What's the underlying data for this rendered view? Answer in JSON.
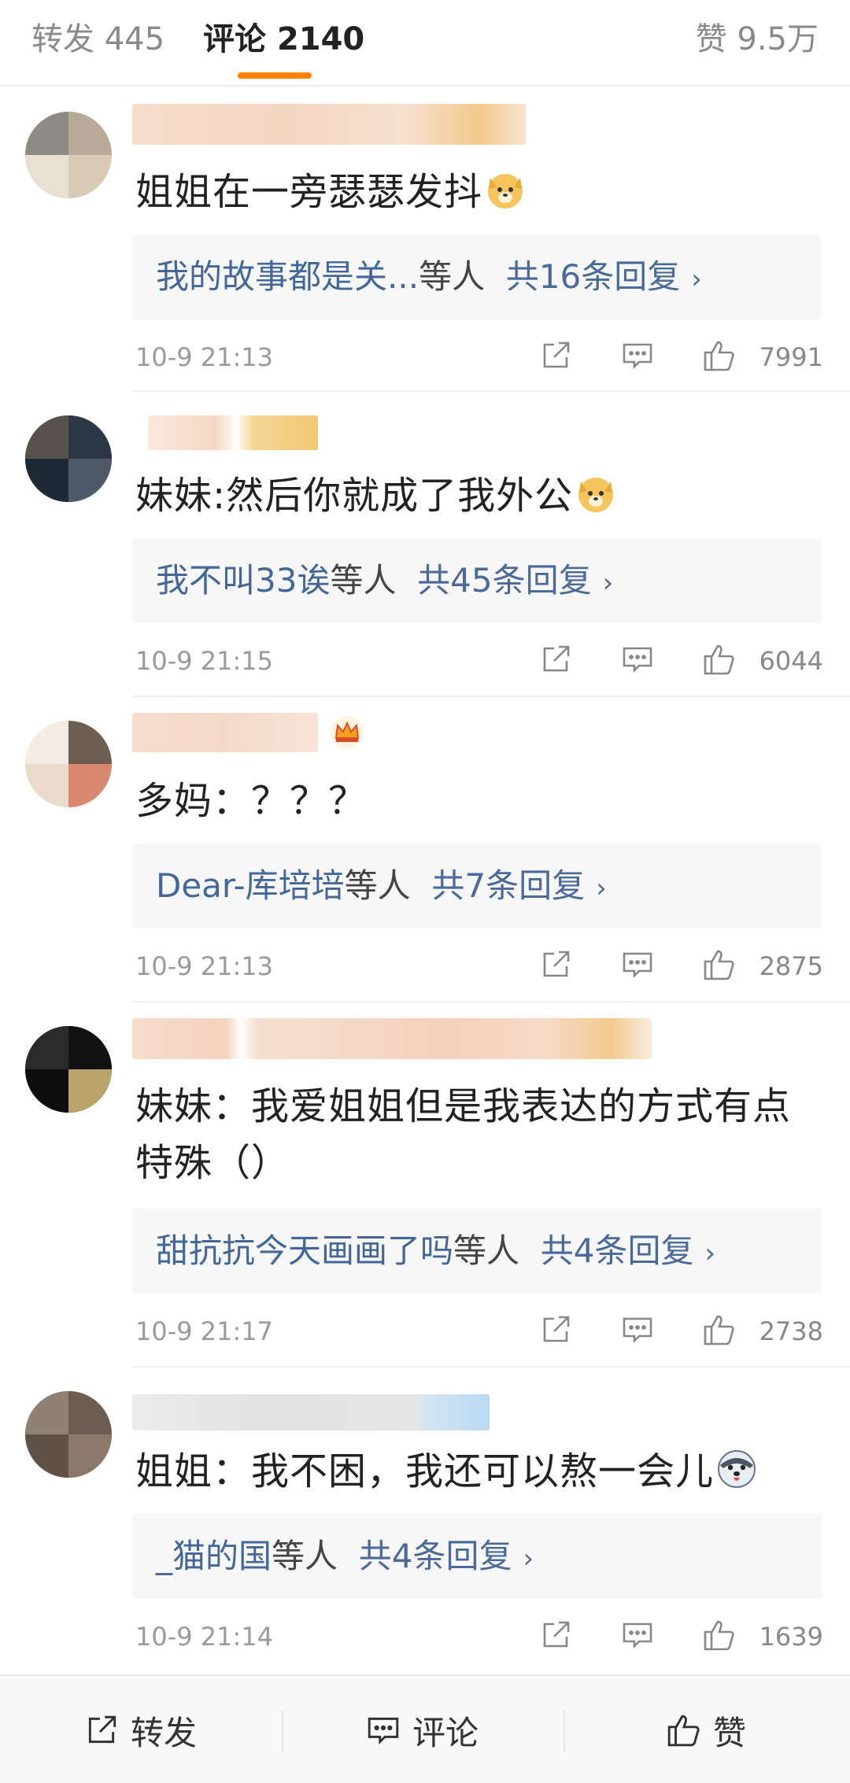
{
  "tabs": {
    "repost_label": "转发",
    "repost_count": "445",
    "comments_label": "评论",
    "comments_count": "2140",
    "likes_label": "赞",
    "likes_count": "9.5万"
  },
  "comments": [
    {
      "text": "姐姐在一旁瑟瑟发抖",
      "emoji": "doge-emoji",
      "reply_users": "我的故事都是关...",
      "reply_etc": "等人",
      "reply_total": "共16条回复",
      "time": "10-9 21:13",
      "likes": "7991"
    },
    {
      "text": "妹妹:然后你就成了我外公",
      "emoji": "doge-emoji",
      "reply_users": "我不叫33诶",
      "reply_etc": "等人",
      "reply_total": "共45条回复",
      "time": "10-9 21:15",
      "likes": "6044"
    },
    {
      "text": "多妈：？？？",
      "emoji": "",
      "reply_users": "Dear-库培培",
      "reply_etc": "等人",
      "reply_total": "共7条回复",
      "time": "10-9 21:13",
      "likes": "2875"
    },
    {
      "text": "妹妹：我爱姐姐但是我表达的方式有点特殊（）",
      "emoji": "",
      "reply_users": "甜抗抗今天画画了吗",
      "reply_etc": "等人",
      "reply_total": "共4条回复",
      "time": "10-9 21:17",
      "likes": "2738"
    },
    {
      "text": "姐姐：我不困，我还可以熬一会儿",
      "emoji": "husky-emoji",
      "reply_users": "_猫的国",
      "reply_etc": "等人",
      "reply_total": "共4条回复",
      "time": "10-9 21:14",
      "likes": "1639"
    }
  ],
  "bottom_bar": {
    "repost_label": "转发",
    "comment_label": "评论",
    "like_label": "赞"
  },
  "colors": {
    "accent": "#ff8200",
    "link": "#4a6a99",
    "muted": "#9a9a9a"
  },
  "icons": [
    "share-icon",
    "comment-icon",
    "thumb-up-icon",
    "crown-icon",
    "chevron-right-icon"
  ]
}
